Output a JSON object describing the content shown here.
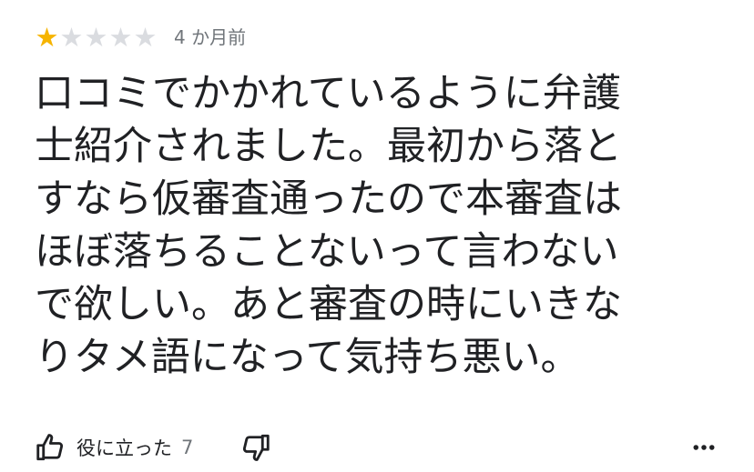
{
  "review": {
    "rating": 1,
    "max_rating": 5,
    "time_ago": "4 か月前",
    "text": "口コミでかかれているように弁護\n士紹介されました。最初から落と\nすなら仮審査通ったので本審査は\nほぼ落ちることないって言わない\nで欲しい。あと審査の時にいきな\nりタメ語になって気持ち悪い。"
  },
  "actions": {
    "helpful_label": "役に立った",
    "helpful_count": "7",
    "icons": {
      "thumbs_up": "thumbs-up-icon",
      "thumbs_down": "thumbs-down-icon",
      "more": "more-options-icon"
    }
  },
  "colors": {
    "star_filled": "#f6b400",
    "star_empty": "#dadce0",
    "text_primary": "#202124",
    "text_secondary": "#70757a"
  }
}
